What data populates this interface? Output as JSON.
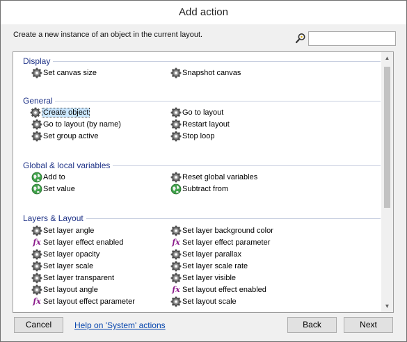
{
  "window": {
    "title": "Add action"
  },
  "description": "Create a new instance of an object in the current layout.",
  "search": {
    "value": "",
    "placeholder": ""
  },
  "groups": [
    {
      "header": "Display",
      "items": [
        {
          "label": "Set canvas size",
          "icon": "gear-icon"
        },
        {
          "label": "Snapshot canvas",
          "icon": "gear-icon"
        }
      ]
    },
    {
      "header": "General",
      "items": [
        {
          "label": "Create object",
          "icon": "gear-icon",
          "selected": true
        },
        {
          "label": "Go to layout",
          "icon": "gear-icon"
        },
        {
          "label": "Go to layout (by name)",
          "icon": "gear-icon"
        },
        {
          "label": "Restart layout",
          "icon": "gear-icon"
        },
        {
          "label": "Set group active",
          "icon": "gear-icon"
        },
        {
          "label": "Stop loop",
          "icon": "gear-icon"
        }
      ]
    },
    {
      "header": "Global & local variables",
      "items": [
        {
          "label": "Add to",
          "icon": "globe-icon"
        },
        {
          "label": "Reset global variables",
          "icon": "gear-icon"
        },
        {
          "label": "Set value",
          "icon": "globe-icon"
        },
        {
          "label": "Subtract from",
          "icon": "globe-icon"
        }
      ]
    },
    {
      "header": "Layers & Layout",
      "items": [
        {
          "label": "Set layer angle",
          "icon": "gear-icon"
        },
        {
          "label": "Set layer background color",
          "icon": "gear-icon"
        },
        {
          "label": "Set layer effect enabled",
          "icon": "fx-icon"
        },
        {
          "label": "Set layer effect parameter",
          "icon": "fx-icon"
        },
        {
          "label": "Set layer opacity",
          "icon": "gear-icon"
        },
        {
          "label": "Set layer parallax",
          "icon": "gear-icon"
        },
        {
          "label": "Set layer scale",
          "icon": "gear-icon"
        },
        {
          "label": "Set layer scale rate",
          "icon": "gear-icon"
        },
        {
          "label": "Set layer transparent",
          "icon": "gear-icon"
        },
        {
          "label": "Set layer visible",
          "icon": "gear-icon"
        },
        {
          "label": "Set layout angle",
          "icon": "gear-icon"
        },
        {
          "label": "Set layout effect enabled",
          "icon": "fx-icon"
        },
        {
          "label": "Set layout effect parameter",
          "icon": "fx-icon"
        },
        {
          "label": "Set layout scale",
          "icon": "gear-icon"
        }
      ]
    }
  ],
  "footer": {
    "cancel_label": "Cancel",
    "help_label": "Help on 'System' actions",
    "back_label": "Back",
    "next_label": "Next"
  }
}
